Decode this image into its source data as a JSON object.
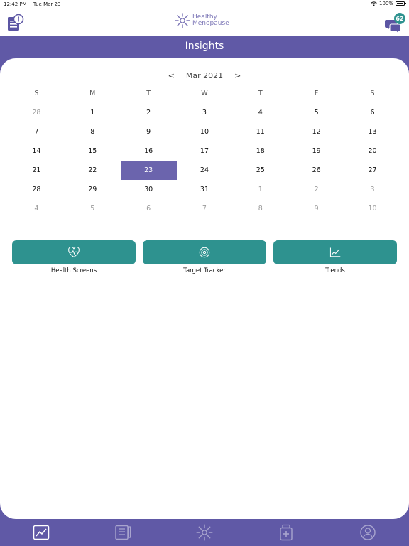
{
  "status_bar": {
    "time": "12:42 PM",
    "date": "Tue Mar 23",
    "battery": "100%"
  },
  "header": {
    "logo_line1": "Healthy",
    "logo_line2": "Menopause",
    "message_count": "62",
    "info_icon": "info-icon",
    "message_icon": "chat-bubbles-icon"
  },
  "page": {
    "title": "Insights"
  },
  "calendar": {
    "month_label": "Mar 2021",
    "prev": "<",
    "next": ">",
    "weekdays": [
      "S",
      "M",
      "T",
      "W",
      "T",
      "F",
      "S"
    ],
    "weeks": [
      [
        {
          "d": "28",
          "m": true
        },
        {
          "d": "1"
        },
        {
          "d": "2"
        },
        {
          "d": "3"
        },
        {
          "d": "4"
        },
        {
          "d": "5"
        },
        {
          "d": "6"
        }
      ],
      [
        {
          "d": "7"
        },
        {
          "d": "8"
        },
        {
          "d": "9"
        },
        {
          "d": "10"
        },
        {
          "d": "11"
        },
        {
          "d": "12"
        },
        {
          "d": "13"
        }
      ],
      [
        {
          "d": "14"
        },
        {
          "d": "15"
        },
        {
          "d": "16"
        },
        {
          "d": "17"
        },
        {
          "d": "18"
        },
        {
          "d": "19"
        },
        {
          "d": "20"
        }
      ],
      [
        {
          "d": "21"
        },
        {
          "d": "22"
        },
        {
          "d": "23",
          "s": true
        },
        {
          "d": "24"
        },
        {
          "d": "25"
        },
        {
          "d": "26"
        },
        {
          "d": "27"
        }
      ],
      [
        {
          "d": "28"
        },
        {
          "d": "29"
        },
        {
          "d": "30"
        },
        {
          "d": "31"
        },
        {
          "d": "1",
          "m": true
        },
        {
          "d": "2",
          "m": true
        },
        {
          "d": "3",
          "m": true
        }
      ],
      [
        {
          "d": "4",
          "m": true
        },
        {
          "d": "5",
          "m": true
        },
        {
          "d": "6",
          "m": true
        },
        {
          "d": "7",
          "m": true
        },
        {
          "d": "8",
          "m": true
        },
        {
          "d": "9",
          "m": true
        },
        {
          "d": "10",
          "m": true
        }
      ]
    ]
  },
  "actions": [
    {
      "label": "Health Screens",
      "icon": "heart-pulse-icon"
    },
    {
      "label": "Target Tracker",
      "icon": "target-icon"
    },
    {
      "label": "Trends",
      "icon": "line-chart-icon"
    }
  ],
  "tabs": [
    {
      "icon": "insights-chart-icon",
      "active": true
    },
    {
      "icon": "journal-icon",
      "active": false
    },
    {
      "icon": "healthy-menopause-logo-icon",
      "active": false
    },
    {
      "icon": "medical-kit-icon",
      "active": false
    },
    {
      "icon": "profile-icon",
      "active": false
    }
  ],
  "colors": {
    "brand_purple": "#6059a6",
    "selected_day": "#6b64ad",
    "accent_teal": "#2e928f"
  }
}
